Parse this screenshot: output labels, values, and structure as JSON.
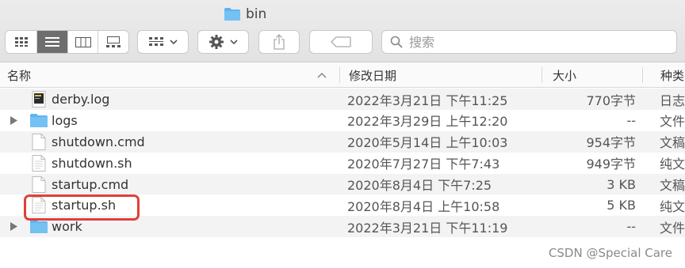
{
  "window": {
    "title": "bin"
  },
  "toolbar": {
    "view_icons": [
      "grid-view-icon",
      "list-view-icon",
      "column-view-icon",
      "gallery-view-icon"
    ],
    "active_view": "list",
    "group_icon": "group-by-icon",
    "action_icon": "gear-icon",
    "share_icon": "share-icon",
    "tag_icon": "tag-icon",
    "search_placeholder": "搜索"
  },
  "columns": {
    "name": "名称",
    "date": "修改日期",
    "size": "大小",
    "kind": "种类"
  },
  "files": [
    {
      "name": "derby.log",
      "date": "2022年3月21日 下午11:25",
      "size": "770字节",
      "kind": "日志",
      "type": "log",
      "expandable": false
    },
    {
      "name": "logs",
      "date": "2022年3月29日 上午12:20",
      "size": "--",
      "kind": "文件夹",
      "type": "folder",
      "expandable": true
    },
    {
      "name": "shutdown.cmd",
      "date": "2020年5月14日 上午10:03",
      "size": "954字节",
      "kind": "文稿",
      "type": "doc",
      "expandable": false
    },
    {
      "name": "shutdown.sh",
      "date": "2020年7月27日 下午7:43",
      "size": "949字节",
      "kind": "纯文本",
      "type": "text",
      "expandable": false
    },
    {
      "name": "startup.cmd",
      "date": "2020年8月4日 下午7:25",
      "size": "3 KB",
      "kind": "文稿",
      "type": "doc",
      "expandable": false
    },
    {
      "name": "startup.sh",
      "date": "2020年8月4日 上午10:58",
      "size": "5 KB",
      "kind": "纯文本",
      "type": "text",
      "expandable": false
    },
    {
      "name": "work",
      "date": "2022年3月21日 下午11:19",
      "size": "--",
      "kind": "文件夹",
      "type": "folder",
      "expandable": true
    }
  ],
  "highlighted_file": "startup.sh",
  "watermark": "CSDN @Special Care",
  "colors": {
    "highlight": "#e0403a",
    "folder": "#5fb4ee",
    "active_view": "#6e6e6e"
  }
}
